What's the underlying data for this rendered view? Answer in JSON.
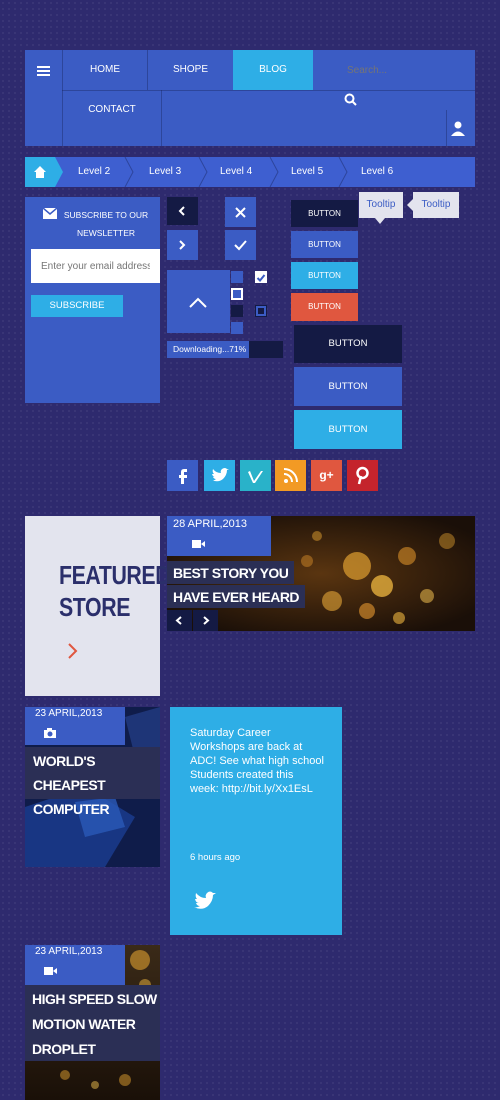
{
  "nav": {
    "items": [
      "HOME",
      "SHOPE",
      "BLOG"
    ],
    "search_placeholder": "Search...",
    "contact": "CONTACT",
    "active_index": 2
  },
  "breadcrumb": {
    "levels": [
      "Level 2",
      "Level 3",
      "Level 4",
      "Level 5",
      "Level 6"
    ]
  },
  "subscribe": {
    "title": "SUBSCRIBE TO OUR NEWSLETTER",
    "email_placeholder": "Enter your email address",
    "button": "SUBSCRIBE"
  },
  "progress": {
    "label": "Downloading...71%",
    "value": 71
  },
  "buttons": {
    "small": [
      "BUTTON",
      "BUTTON",
      "BUTTON",
      "BUTTON"
    ],
    "large": [
      "BUTTON",
      "BUTTON",
      "BUTTON"
    ]
  },
  "tooltips": [
    "Tooltip",
    "Tooltip"
  ],
  "social": [
    "f",
    "t",
    "v",
    "rss",
    "g+",
    "p"
  ],
  "featured": {
    "line1": "FEATURED",
    "line2": "STORE"
  },
  "story": {
    "date": "28 APRIL,2013",
    "title1": "BEST STORY YOU",
    "title2": "HAVE EVER HEARD"
  },
  "computer": {
    "date": "23 APRIL,2013",
    "title1": "WORLD'S CHEAPEST",
    "title2": "COMPUTER"
  },
  "tweet": {
    "text": "Saturday Career Workshops are back at ADC! See what high school Students created this week: http://bit.ly/Xx1EsL",
    "time": "6 hours ago"
  },
  "water": {
    "date": "23 APRIL,2013",
    "title1": "HIGH SPEED SLOW",
    "title2": "MOTION WATER",
    "title3": "DROPLET"
  },
  "colors": {
    "bg": "#2e2a6e",
    "primary": "#3b5cc4",
    "cyan": "#2eaee6",
    "dark": "#141a44",
    "red": "#e0573f"
  }
}
